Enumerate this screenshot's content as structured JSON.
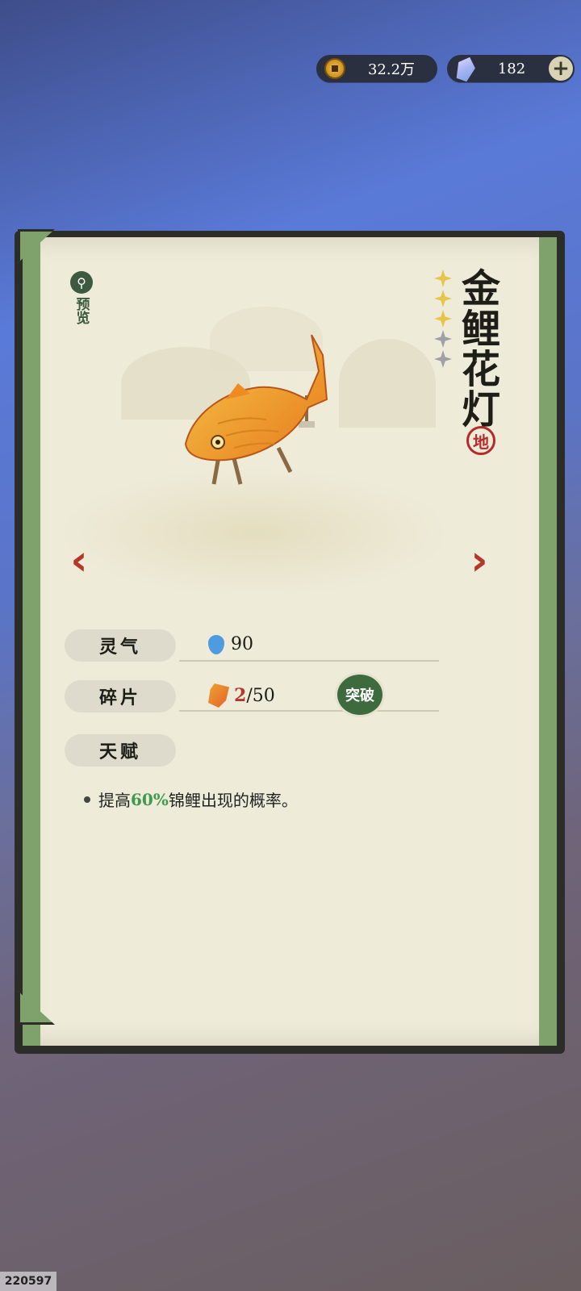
{
  "currency": {
    "coins": "32.2万",
    "gems": "182",
    "add_label": "+"
  },
  "item": {
    "name": "金鲤花灯",
    "rank_seal": "地",
    "stars_total": 5,
    "stars_filled": 3
  },
  "preview": {
    "icon": "magnify-icon",
    "label": "预览"
  },
  "nav": {
    "prev": "‹",
    "next": "›"
  },
  "stats": {
    "spirit": {
      "label": "灵气",
      "value": "90"
    },
    "fragments": {
      "label": "碎片",
      "current": "2",
      "total": "/50",
      "action": "突破"
    },
    "talent": {
      "label": "天赋"
    }
  },
  "talent_desc": {
    "prefix": "提高",
    "highlight": "60%",
    "suffix": "锦鲤出现的概率。"
  },
  "footer": {
    "id": "220597"
  },
  "colors": {
    "accent_green": "#3d6b3e",
    "highlight_green": "#3f9a4d",
    "arrow_red": "#b4372b"
  }
}
